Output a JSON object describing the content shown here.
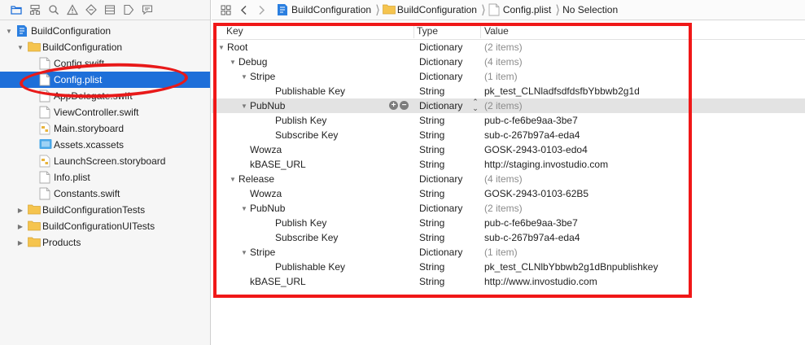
{
  "navigator": {
    "toolbar_icons": [
      "folder-icon",
      "hierarchy-icon",
      "search-icon",
      "warning-icon",
      "test-diamond-icon",
      "list-icon",
      "tag-icon",
      "comment-icon"
    ],
    "tree": [
      {
        "label": "BuildConfiguration",
        "level": 0,
        "icon": "project-icon",
        "disclosure": "open"
      },
      {
        "label": "BuildConfiguration",
        "level": 1,
        "icon": "folder-icon",
        "disclosure": "open"
      },
      {
        "label": "Config.swift",
        "level": 2,
        "icon": "file-icon",
        "disclosure": "none"
      },
      {
        "label": "Config.plist",
        "level": 2,
        "icon": "file-icon",
        "disclosure": "none",
        "selected": true
      },
      {
        "label": "AppDelegate.swift",
        "level": 2,
        "icon": "file-icon",
        "disclosure": "none"
      },
      {
        "label": "ViewController.swift",
        "level": 2,
        "icon": "file-icon",
        "disclosure": "none"
      },
      {
        "label": "Main.storyboard",
        "level": 2,
        "icon": "storyboard-icon",
        "disclosure": "none"
      },
      {
        "label": "Assets.xcassets",
        "level": 2,
        "icon": "assets-icon",
        "disclosure": "none"
      },
      {
        "label": "LaunchScreen.storyboard",
        "level": 2,
        "icon": "storyboard-icon",
        "disclosure": "none"
      },
      {
        "label": "Info.plist",
        "level": 2,
        "icon": "file-icon",
        "disclosure": "none"
      },
      {
        "label": "Constants.swift",
        "level": 2,
        "icon": "file-icon",
        "disclosure": "none"
      },
      {
        "label": "BuildConfigurationTests",
        "level": 1,
        "icon": "folder-icon",
        "disclosure": "closed"
      },
      {
        "label": "BuildConfigurationUITests",
        "level": 1,
        "icon": "folder-icon",
        "disclosure": "closed"
      },
      {
        "label": "Products",
        "level": 1,
        "icon": "folder-icon",
        "disclosure": "closed"
      }
    ]
  },
  "jumpbar": {
    "crumbs": [
      {
        "label": "BuildConfiguration",
        "icon": "project-icon"
      },
      {
        "label": "BuildConfiguration",
        "icon": "folder-icon"
      },
      {
        "label": "Config.plist",
        "icon": "file-icon"
      },
      {
        "label": "No Selection",
        "icon": ""
      }
    ]
  },
  "plist": {
    "headers": {
      "key": "Key",
      "type": "Type",
      "value": "Value"
    },
    "rows": [
      {
        "key": "Root",
        "type": "Dictionary",
        "value": "(2 items)",
        "level": 0,
        "disclosure": "open",
        "dim": true
      },
      {
        "key": "Debug",
        "type": "Dictionary",
        "value": "(4 items)",
        "level": 1,
        "disclosure": "open",
        "dim": true
      },
      {
        "key": "Stripe",
        "type": "Dictionary",
        "value": "(1 item)",
        "level": 2,
        "disclosure": "open",
        "dim": true
      },
      {
        "key": "Publishable Key",
        "type": "String",
        "value": "pk_test_CLNladfsdfdsfbYbbwb2g1d",
        "level": 3,
        "disclosure": "none"
      },
      {
        "key": "PubNub",
        "type": "Dictionary",
        "value": "(2 items)",
        "level": 2,
        "disclosure": "open",
        "dim": true,
        "highlighted": true
      },
      {
        "key": "Publish Key",
        "type": "String",
        "value": "pub-c-fe6be9aa-3be7",
        "level": 3,
        "disclosure": "none"
      },
      {
        "key": "Subscribe Key",
        "type": "String",
        "value": "sub-c-267b97a4-eda4",
        "level": 3,
        "disclosure": "none"
      },
      {
        "key": "Wowza",
        "type": "String",
        "value": "GOSK-2943-0103-edo4",
        "level": 2,
        "disclosure": "none"
      },
      {
        "key": "kBASE_URL",
        "type": "String",
        "value": "http://staging.invostudio.com",
        "level": 2,
        "disclosure": "none"
      },
      {
        "key": "Release",
        "type": "Dictionary",
        "value": "(4 items)",
        "level": 1,
        "disclosure": "open",
        "dim": true
      },
      {
        "key": "Wowza",
        "type": "String",
        "value": "GOSK-2943-0103-62B5",
        "level": 2,
        "disclosure": "none"
      },
      {
        "key": "PubNub",
        "type": "Dictionary",
        "value": "(2 items)",
        "level": 2,
        "disclosure": "open",
        "dim": true
      },
      {
        "key": "Publish Key",
        "type": "String",
        "value": "pub-c-fe6be9aa-3be7",
        "level": 3,
        "disclosure": "none"
      },
      {
        "key": "Subscribe Key",
        "type": "String",
        "value": "sub-c-267b97a4-eda4",
        "level": 3,
        "disclosure": "none"
      },
      {
        "key": "Stripe",
        "type": "Dictionary",
        "value": "(1 item)",
        "level": 2,
        "disclosure": "open",
        "dim": true
      },
      {
        "key": "Publishable Key",
        "type": "String",
        "value": "pk_test_CLNlbYbbwb2g1dBnpublishkey",
        "level": 3,
        "disclosure": "none"
      },
      {
        "key": "kBASE_URL",
        "type": "String",
        "value": "http://www.invostudio.com",
        "level": 2,
        "disclosure": "none"
      }
    ]
  },
  "colors": {
    "selection": "#1e6fd9",
    "annotation_red": "#f01818",
    "folder": "#f5c44e",
    "project": "#2b7fe0"
  }
}
